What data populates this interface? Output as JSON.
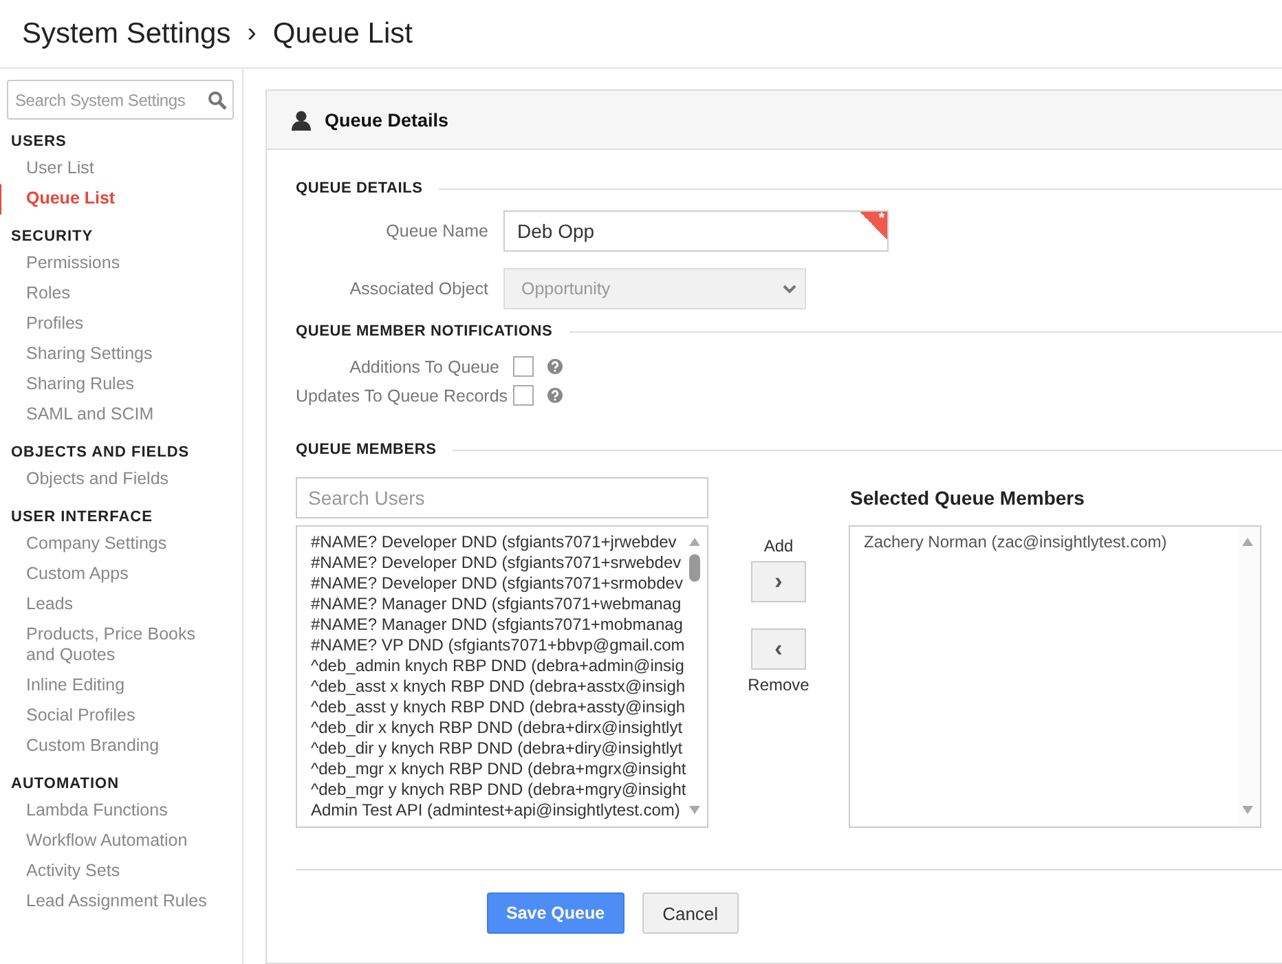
{
  "breadcrumb": {
    "root": "System Settings",
    "separator": "›",
    "current": "Queue List"
  },
  "sidebar": {
    "search": {
      "placeholder": "Search System Settings"
    },
    "sections": [
      {
        "title": "USERS",
        "items": [
          {
            "label": "User List",
            "selected": false
          },
          {
            "label": "Queue List",
            "selected": true
          }
        ]
      },
      {
        "title": "SECURITY",
        "items": [
          {
            "label": "Permissions",
            "selected": false
          },
          {
            "label": "Roles",
            "selected": false
          },
          {
            "label": "Profiles",
            "selected": false
          },
          {
            "label": "Sharing Settings",
            "selected": false
          },
          {
            "label": "Sharing Rules",
            "selected": false
          },
          {
            "label": "SAML and SCIM",
            "selected": false
          }
        ]
      },
      {
        "title": "OBJECTS AND FIELDS",
        "items": [
          {
            "label": "Objects and Fields",
            "selected": false
          }
        ]
      },
      {
        "title": "USER INTERFACE",
        "items": [
          {
            "label": "Company Settings",
            "selected": false
          },
          {
            "label": "Custom Apps",
            "selected": false
          },
          {
            "label": "Leads",
            "selected": false
          },
          {
            "label": "Products, Price Books and Quotes",
            "selected": false
          },
          {
            "label": "Inline Editing",
            "selected": false
          },
          {
            "label": "Social Profiles",
            "selected": false
          },
          {
            "label": "Custom Branding",
            "selected": false
          }
        ]
      },
      {
        "title": "AUTOMATION",
        "items": [
          {
            "label": "Lambda Functions",
            "selected": false
          },
          {
            "label": "Workflow Automation",
            "selected": false
          },
          {
            "label": "Activity Sets",
            "selected": false
          },
          {
            "label": "Lead Assignment Rules",
            "selected": false
          }
        ]
      }
    ]
  },
  "panel": {
    "title": "Queue Details",
    "details": {
      "heading": "QUEUE DETAILS",
      "queue_name": {
        "label": "Queue Name",
        "value": "Deb Opp",
        "required_mark": "*"
      },
      "associated_object": {
        "label": "Associated Object",
        "value": "Opportunity",
        "disabled": true
      }
    },
    "notifications": {
      "heading": "QUEUE MEMBER NOTIFICATIONS",
      "options": [
        {
          "label": "Additions To Queue",
          "checked": false
        },
        {
          "label": "Updates To Queue Records",
          "checked": false
        }
      ]
    },
    "members": {
      "heading": "QUEUE MEMBERS",
      "search": {
        "placeholder": "Search Users"
      },
      "available": [
        "#NAME? Developer DND (sfgiants7071+jrwebdev",
        "#NAME? Developer DND (sfgiants7071+srwebdev",
        "#NAME? Developer DND (sfgiants7071+srmobdev",
        "#NAME? Manager DND (sfgiants7071+webmanag",
        "#NAME? Manager DND (sfgiants7071+mobmanag",
        "#NAME? VP DND (sfgiants7071+bbvp@gmail.com",
        "^deb_admin knych RBP DND (debra+admin@insig",
        "^deb_asst x knych RBP DND (debra+asstx@insigh",
        "^deb_asst y knych RBP DND (debra+assty@insigh",
        "^deb_dir x knych RBP DND (debra+dirx@insightlyt",
        "^deb_dir y knych RBP DND (debra+diry@insightlyt",
        "^deb_mgr x knych RBP DND (debra+mgrx@insight",
        "^deb_mgr y knych RBP DND (debra+mgry@insight",
        "Admin Test API (admintest+api@insightlytest.com)"
      ],
      "add_label": "Add",
      "add_glyph": "›",
      "remove_glyph": "‹",
      "remove_label": "Remove",
      "selected_heading": "Selected Queue Members",
      "selected": [
        "Zachery Norman (zac@insightlytest.com)"
      ]
    }
  },
  "buttons": [
    {
      "label": "Save Queue",
      "kind": "primary"
    },
    {
      "label": "Cancel",
      "kind": "secondary"
    }
  ]
}
